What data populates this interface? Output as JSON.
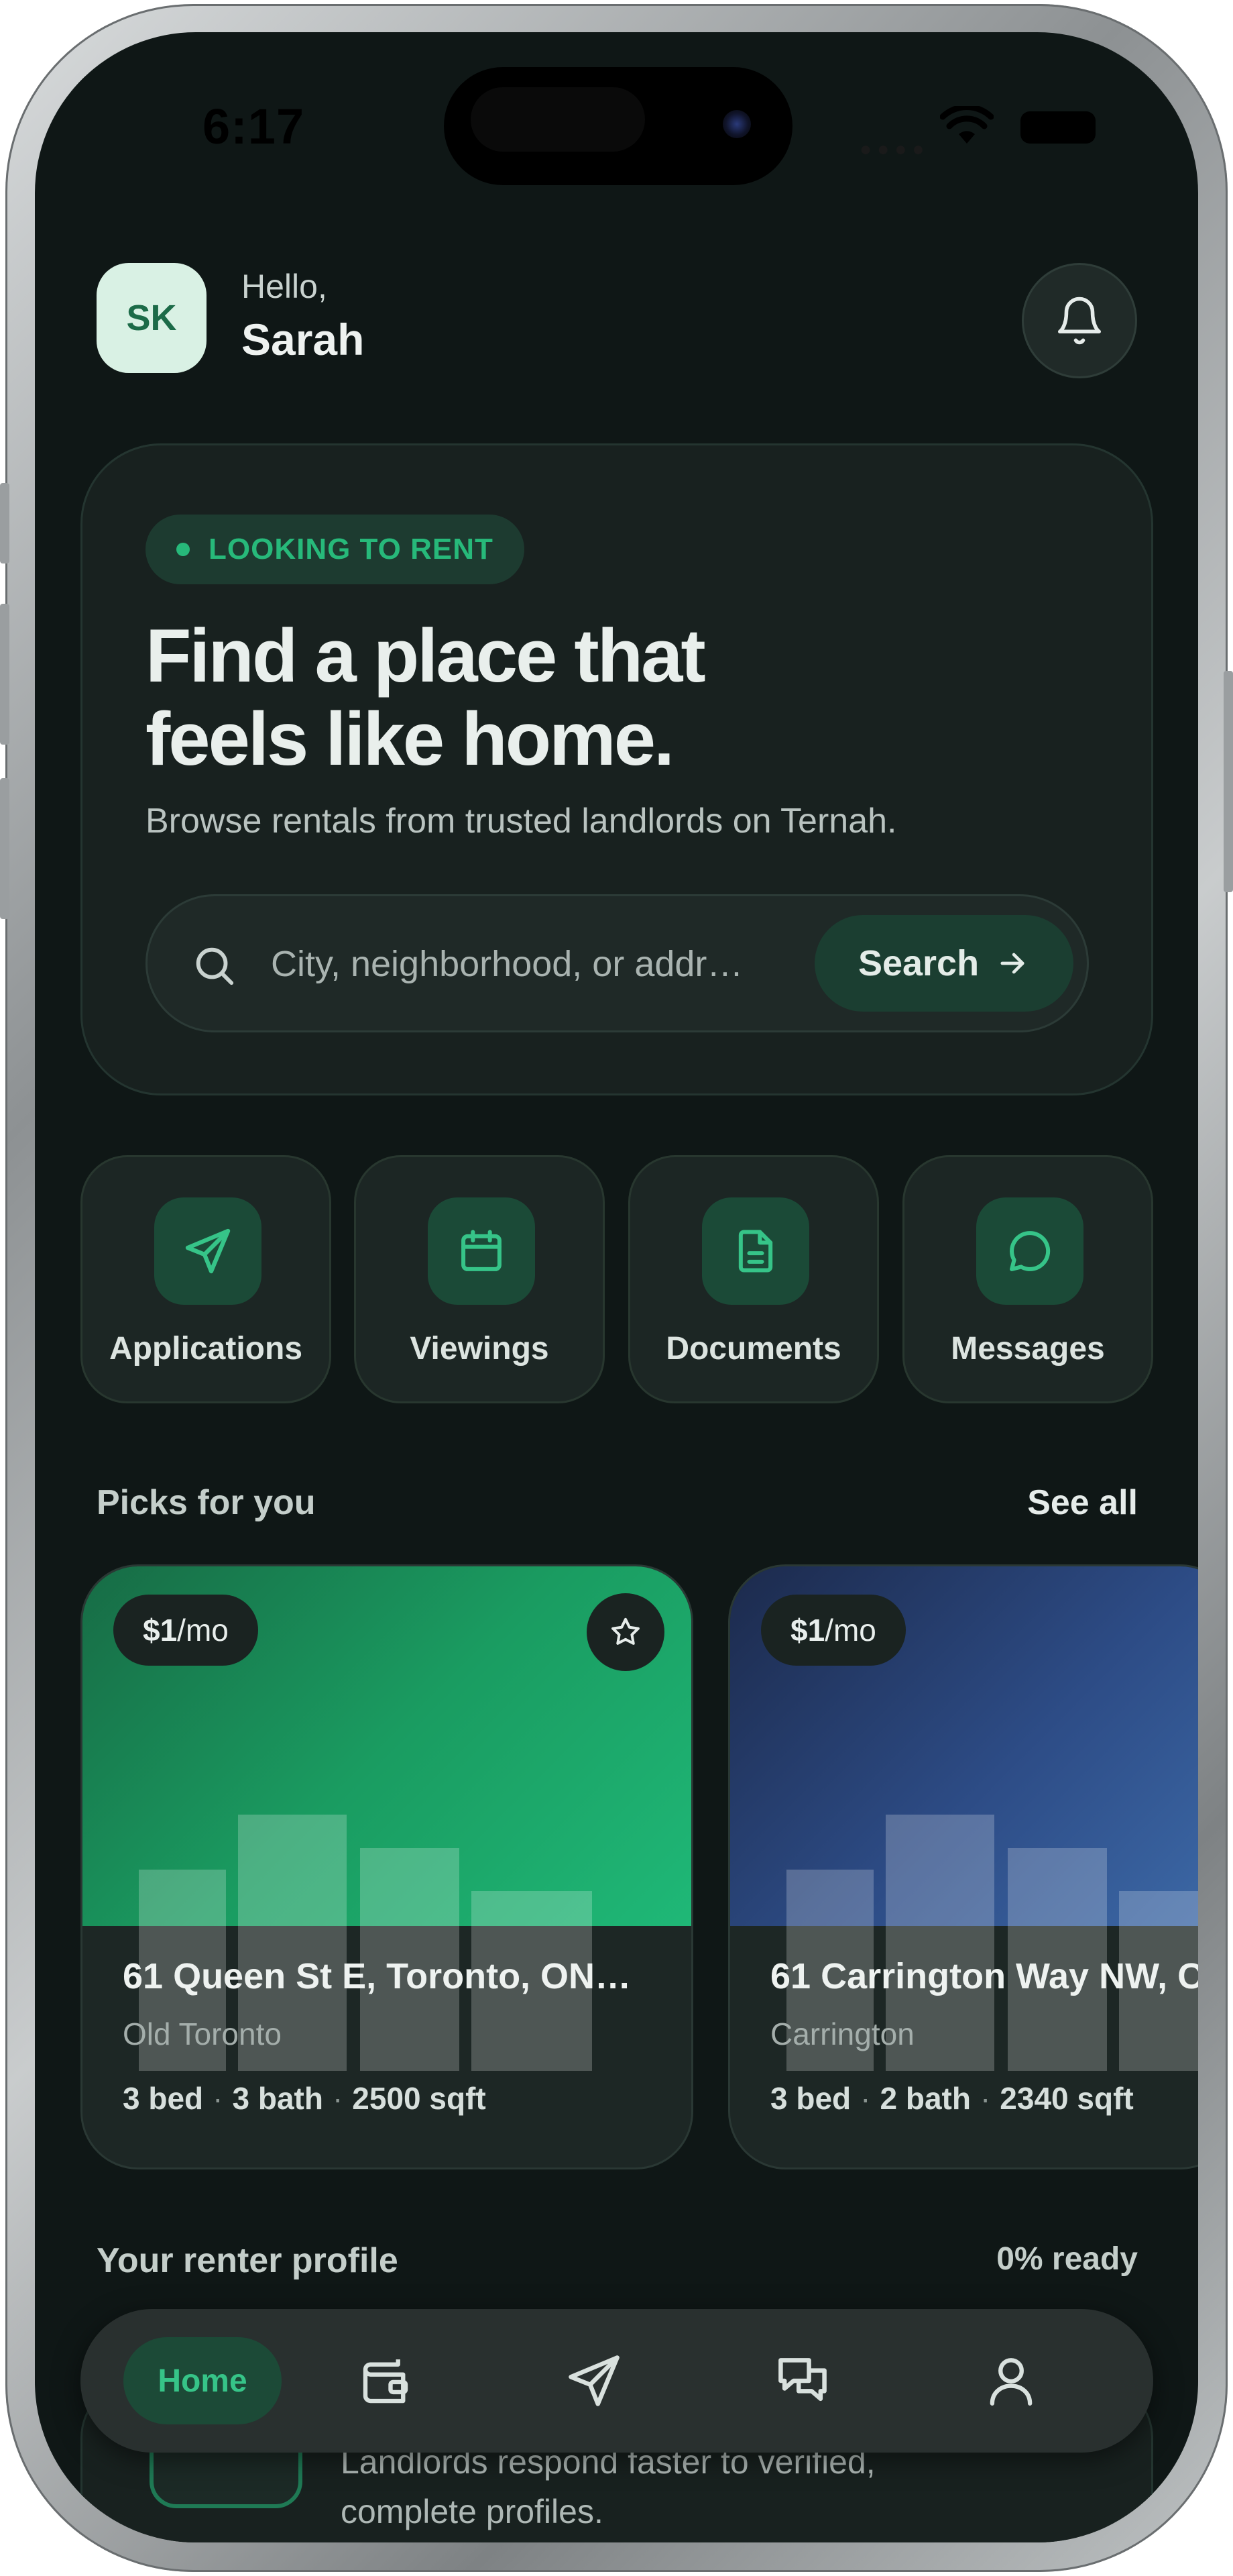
{
  "status_bar": {
    "time": "6:17"
  },
  "header": {
    "avatar_initials": "SK",
    "greeting": "Hello,",
    "username": "Sarah"
  },
  "hero": {
    "badge": "LOOKING TO RENT",
    "title_line1": "Find a place that",
    "title_line2": "feels like home.",
    "subtitle": "Browse rentals from trusted landlords on Ternah.",
    "search_placeholder": "City, neighborhood, or addr…",
    "search_button": "Search"
  },
  "quick_actions": [
    {
      "label": "Applications",
      "icon": "send-icon"
    },
    {
      "label": "Viewings",
      "icon": "calendar-icon"
    },
    {
      "label": "Documents",
      "icon": "document-icon"
    },
    {
      "label": "Messages",
      "icon": "chat-bubble-icon"
    }
  ],
  "picks": {
    "title": "Picks for you",
    "see_all": "See all",
    "listings": [
      {
        "price": "$1",
        "period": "/mo",
        "address": "61 Queen St E, Toronto, ON …",
        "neighborhood": "Old Toronto",
        "beds": "3 bed",
        "baths": "3 bath",
        "sqft": "2500 sqft",
        "sep": "·"
      },
      {
        "price": "$1",
        "period": "/mo",
        "address": "61 Carrington Way NW, C",
        "neighborhood": "Carrington",
        "beds": "3 bed",
        "baths": "2 bath",
        "sqft": "2340 sqft",
        "sep": "·"
      }
    ]
  },
  "profile": {
    "title": "Your renter profile",
    "ready": "0% ready",
    "text_line1": "Landlords respond faster to verified,",
    "text_line2": "complete profiles."
  },
  "nav": {
    "home": "Home",
    "icons": [
      "wallet-icon",
      "send-icon",
      "chat-icon",
      "profile-icon"
    ]
  },
  "colors": {
    "background": "#0f1716",
    "accent": "#27b97a",
    "card": "#1d2725"
  }
}
